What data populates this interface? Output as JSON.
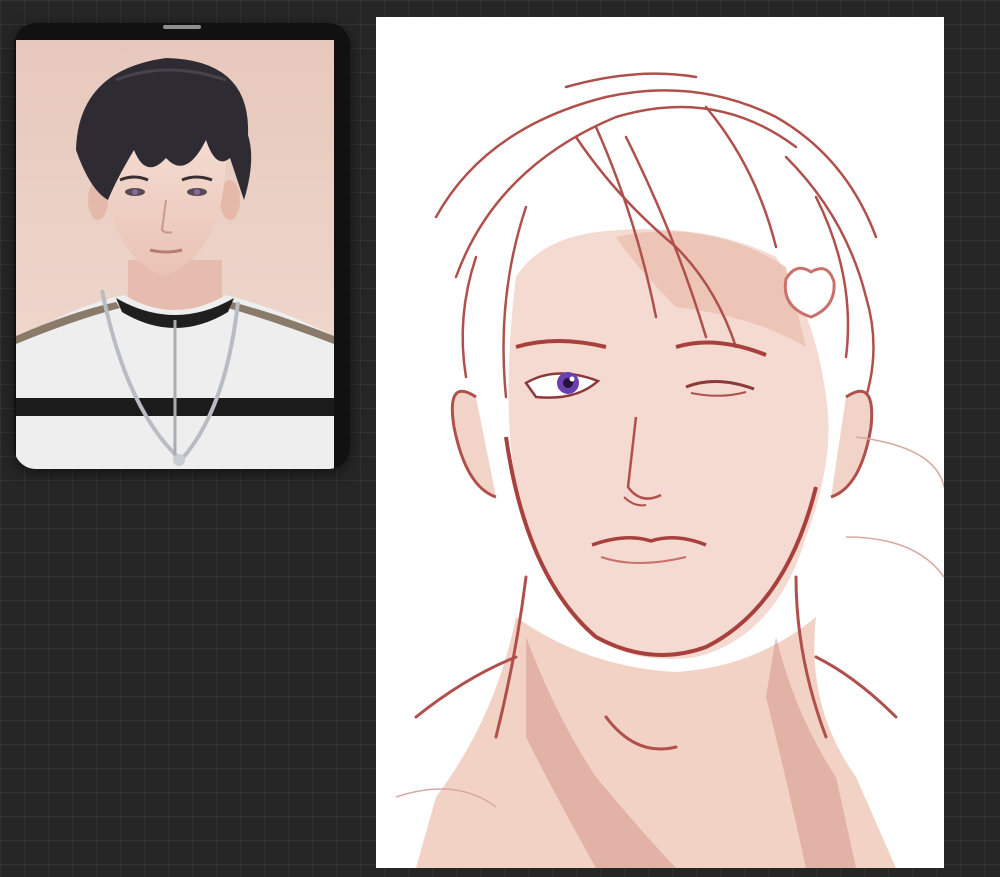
{
  "app": {
    "canvas_background": "#262626",
    "grid_color": "rgba(255,255,255,0.05)"
  },
  "reference_window": {
    "frame_color": "#111111",
    "handle_color": "#8e8e8e",
    "photo_background": "#e9cfc3"
  },
  "canvas": {
    "paper_color": "#ffffff",
    "line_color": "#b0504c",
    "skin_tone": "#f0cdbf",
    "shadow_tone": "#d79c8f",
    "eye_color": "#6a3fb0"
  }
}
